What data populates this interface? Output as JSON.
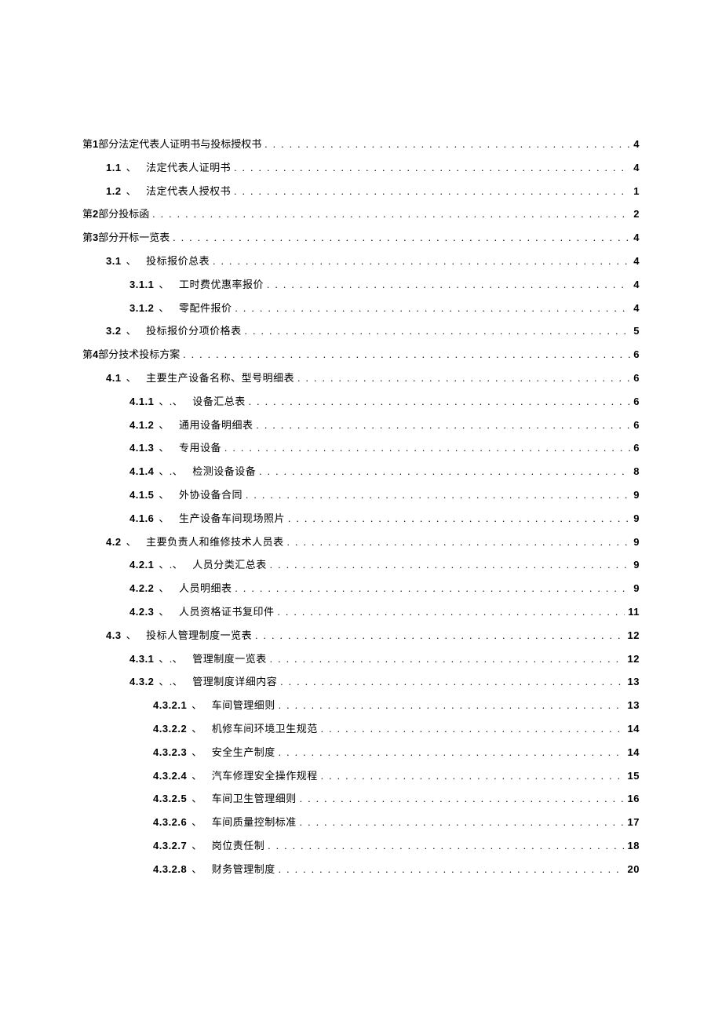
{
  "toc": [
    {
      "level": 1,
      "num": "",
      "sep": "",
      "title_prefix": "第",
      "title_mid": "1",
      "title_suffix": "部分法定代表人证明书与投标授权书",
      "page": "4"
    },
    {
      "level": 2,
      "num": "1.1",
      "sep": "、",
      "title": "法定代表人证明书",
      "page": "4"
    },
    {
      "level": 2,
      "num": "1.2",
      "sep": "、",
      "title": "法定代表人授权书",
      "page": "1"
    },
    {
      "level": 1,
      "num": "",
      "sep": "",
      "title_prefix": "第",
      "title_mid": "2",
      "title_suffix": "部分投标函",
      "page": "2"
    },
    {
      "level": 1,
      "num": "",
      "sep": "",
      "title_prefix": "第",
      "title_mid": "3",
      "title_suffix": "部分开标一览表",
      "page": "4"
    },
    {
      "level": 2,
      "num": "3.1",
      "sep": "、",
      "title": "投标报价总表",
      "page": "4"
    },
    {
      "level": 3,
      "num": "3.1.1",
      "sep": "、",
      "title": "工时费优惠率报价",
      "page": "4"
    },
    {
      "level": 3,
      "num": "3.1.2",
      "sep": "、",
      "title": "零配件报价",
      "page": "4"
    },
    {
      "level": 2,
      "num": "3.2",
      "sep": "、",
      "title": "投标报价分项价格表",
      "page": "5"
    },
    {
      "level": 1,
      "num": "",
      "sep": "",
      "title_prefix": "第",
      "title_mid": "4",
      "title_suffix": "部分技术投标方案",
      "page": "6"
    },
    {
      "level": 2,
      "num": "4.1",
      "sep": "、",
      "title": "主要生产设备名称、型号明细表",
      "page": "6"
    },
    {
      "level": 3,
      "num": "4.1.1",
      "sep": "、.、",
      "title": "设备汇总表",
      "page": "6"
    },
    {
      "level": 3,
      "num": "4.1.2",
      "sep": "、",
      "title": "通用设备明细表",
      "page": "6"
    },
    {
      "level": 3,
      "num": "4.1.3",
      "sep": "、",
      "title": "专用设备",
      "page": "6"
    },
    {
      "level": 3,
      "num": "4.1.4",
      "sep": "、.、",
      "title": "检测设备设备",
      "page": "8"
    },
    {
      "level": 3,
      "num": "4.1.5",
      "sep": "、",
      "title": "外协设备合同",
      "page": "9"
    },
    {
      "level": 3,
      "num": "4.1.6",
      "sep": "、",
      "title": "生产设备车间现场照片",
      "page": "9"
    },
    {
      "level": 2,
      "num": "4.2",
      "sep": "、",
      "title": "主要负责人和维修技术人员表",
      "page": "9"
    },
    {
      "level": 3,
      "num": "4.2.1",
      "sep": "、.、",
      "title": "人员分类汇总表",
      "page": "9"
    },
    {
      "level": 3,
      "num": "4.2.2",
      "sep": "、",
      "title": "人员明细表",
      "page": "9"
    },
    {
      "level": 3,
      "num": "4.2.3",
      "sep": "、",
      "title": "人员资格证书复印件",
      "page": "11"
    },
    {
      "level": 2,
      "num": "4.3",
      "sep": "、",
      "title": "投标人管理制度一览表",
      "page": "12"
    },
    {
      "level": 3,
      "num": "4.3.1",
      "sep": "、.、",
      "title": "管理制度一览表",
      "page": "12"
    },
    {
      "level": 3,
      "num": "4.3.2",
      "sep": "、.、",
      "title": "管理制度详细内容",
      "page": "13"
    },
    {
      "level": 4,
      "num": "4.3.2.1",
      "sep": "、",
      "title": "车间管理细则",
      "page": "13"
    },
    {
      "level": 4,
      "num": "4.3.2.2",
      "sep": "、",
      "title": "机修车间环境卫生规范",
      "page": "14"
    },
    {
      "level": 4,
      "num": "4.3.2.3",
      "sep": "、",
      "title": "安全生产制度",
      "page": "14"
    },
    {
      "level": 4,
      "num": "4.3.2.4",
      "sep": "、",
      "title": "汽车修理安全操作规程",
      "page": "15"
    },
    {
      "level": 4,
      "num": "4.3.2.5",
      "sep": "、",
      "title": "车间卫生管理细则",
      "page": "16"
    },
    {
      "level": 4,
      "num": "4.3.2.6",
      "sep": "、",
      "title": "车间质量控制标准",
      "page": "17"
    },
    {
      "level": 4,
      "num": "4.3.2.7",
      "sep": "、",
      "title": "岗位责任制",
      "page": "18"
    },
    {
      "level": 4,
      "num": "4.3.2.8",
      "sep": "、",
      "title": "财务管理制度",
      "page": "20"
    }
  ]
}
